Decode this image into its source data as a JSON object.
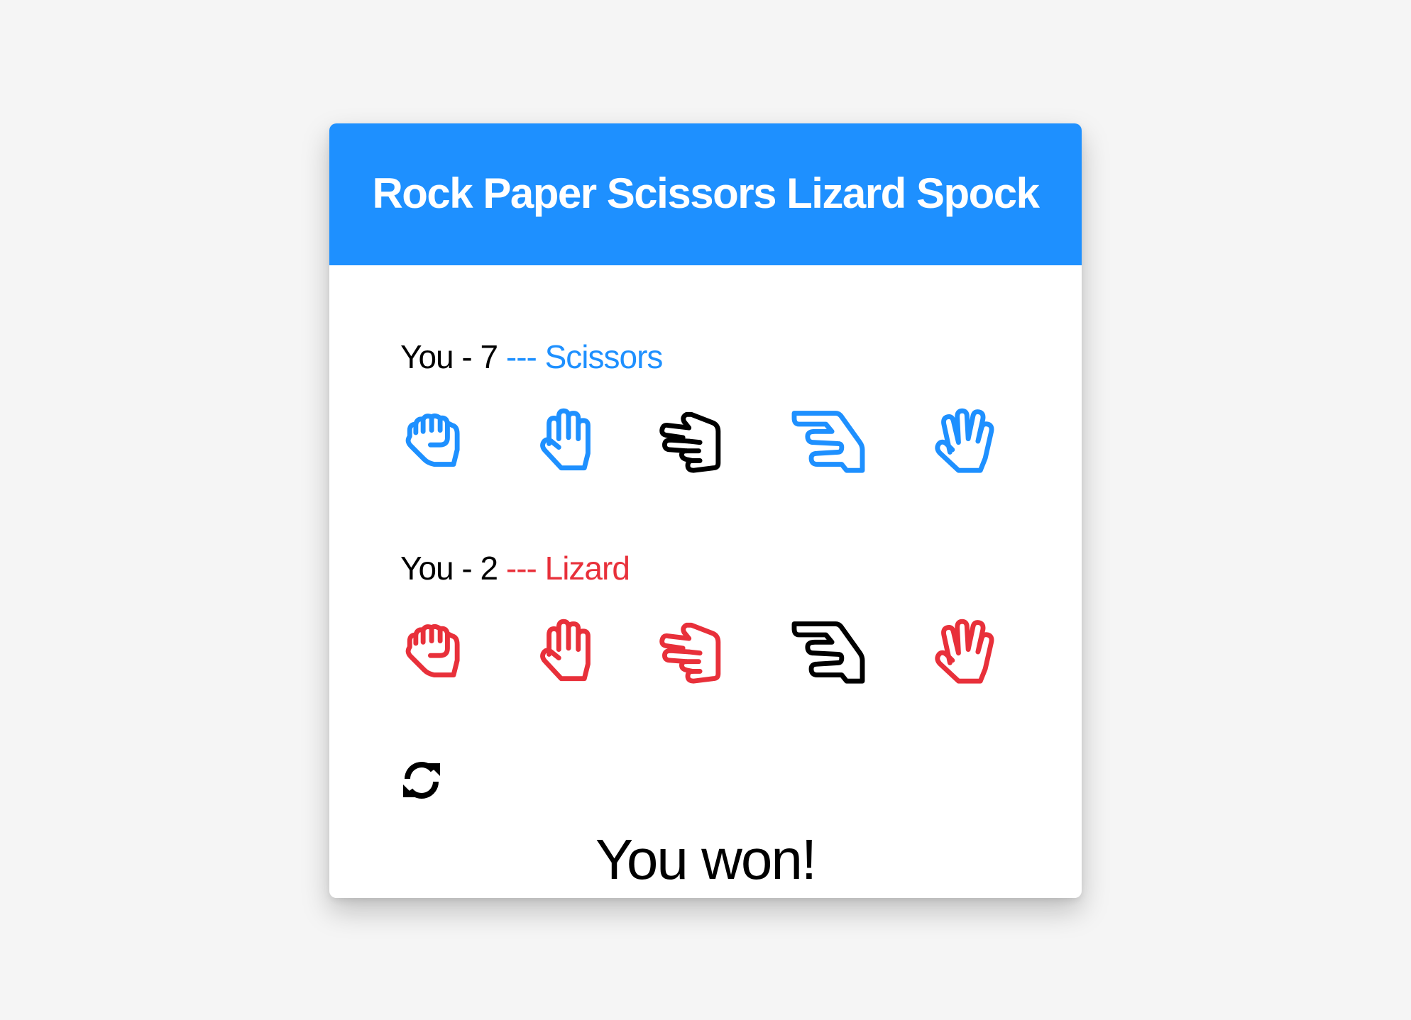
{
  "title": "Rock Paper Scissors Lizard Spock",
  "colors": {
    "header": "#1e90ff",
    "player1": "#1e90ff",
    "player2": "#e8303a",
    "selected": "#000000"
  },
  "player1": {
    "name": "You",
    "score_separator": " - ",
    "score": "7",
    "choice_separator": " --- ",
    "choice": "Scissors",
    "hands": [
      {
        "icon": "hand-rock-icon",
        "selected": false
      },
      {
        "icon": "hand-paper-icon",
        "selected": false
      },
      {
        "icon": "hand-scissors-icon",
        "selected": true
      },
      {
        "icon": "hand-lizard-icon",
        "selected": false
      },
      {
        "icon": "hand-spock-icon",
        "selected": false
      }
    ]
  },
  "player2": {
    "name": "You",
    "score_separator": " - ",
    "score": "2",
    "choice_separator": " --- ",
    "choice": "Lizard",
    "hands": [
      {
        "icon": "hand-rock-icon",
        "selected": false
      },
      {
        "icon": "hand-paper-icon",
        "selected": false
      },
      {
        "icon": "hand-scissors-icon",
        "selected": false
      },
      {
        "icon": "hand-lizard-icon",
        "selected": true
      },
      {
        "icon": "hand-spock-icon",
        "selected": false
      }
    ]
  },
  "reset_icon": "refresh-icon",
  "result": "You won!"
}
